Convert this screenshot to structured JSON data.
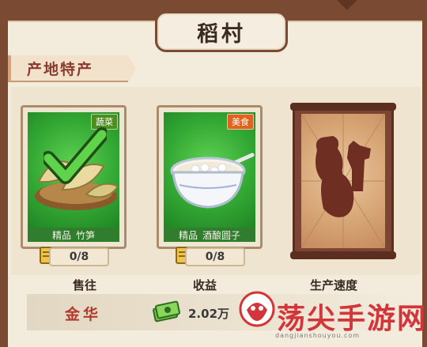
{
  "title": "稻村",
  "section_tab": "产地特产",
  "cards": [
    {
      "badge": "蔬菜",
      "badge_color": "#4c8f1e",
      "quality": "精品",
      "name": "竹笋",
      "count": "0/8",
      "icon": "bamboo-shoots-with-checkmark",
      "selected": true
    },
    {
      "badge": "美食",
      "badge_color": "#e0621c",
      "quality": "精品",
      "name": "酒酿圆子",
      "count": "0/8",
      "icon": "rice-ball-soup-bowl",
      "selected": false
    },
    {
      "locked": true,
      "icon": "locked-jar-silhouette-scroll"
    }
  ],
  "stats": {
    "headers": [
      "售往",
      "收益",
      "生产速度"
    ],
    "sell_to": "金华",
    "income": "2.02万"
  },
  "watermark": {
    "brand": "荡尖手游网",
    "domain": "dangjianshouyou.com"
  },
  "colors": {
    "frame": "#7a4a32",
    "accent_red": "#b03a2e",
    "card_green": "#33a834"
  }
}
